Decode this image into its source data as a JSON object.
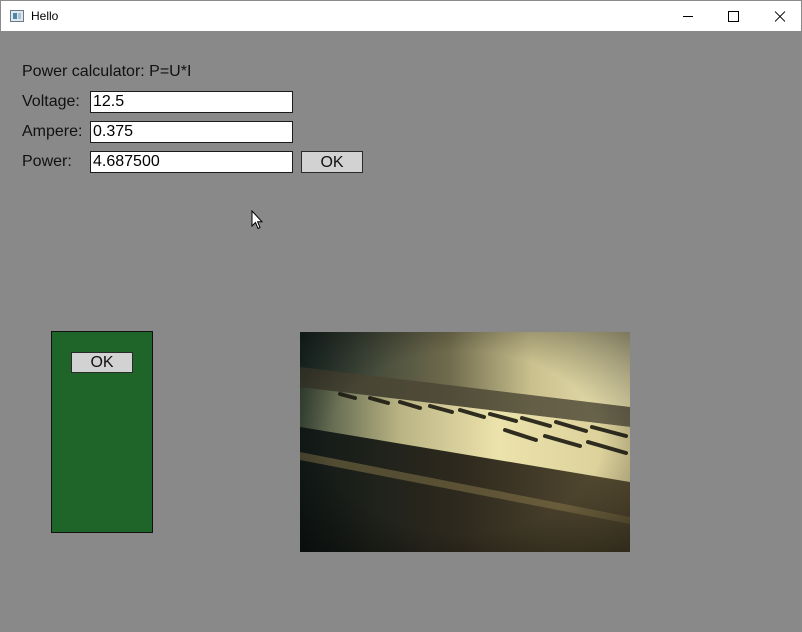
{
  "window": {
    "title": "Hello",
    "icon": "application-window-icon",
    "controls": [
      "minimize-icon",
      "maximize-icon",
      "close-icon"
    ]
  },
  "form": {
    "heading": "Power calculator: P=U*I",
    "voltage_label": "Voltage:",
    "voltage_value": "12.5",
    "ampere_label": "Ampere:",
    "ampere_value": "0.375",
    "power_label": "Power:",
    "power_value": "4.687500",
    "ok_label": "OK"
  },
  "panel": {
    "color": "#1f6429",
    "ok_label": "OK"
  },
  "image": {
    "subject": "piano keys photo"
  },
  "colors": {
    "background": "#898989",
    "panel": "#1f6429",
    "button": "#d2d2d2"
  }
}
